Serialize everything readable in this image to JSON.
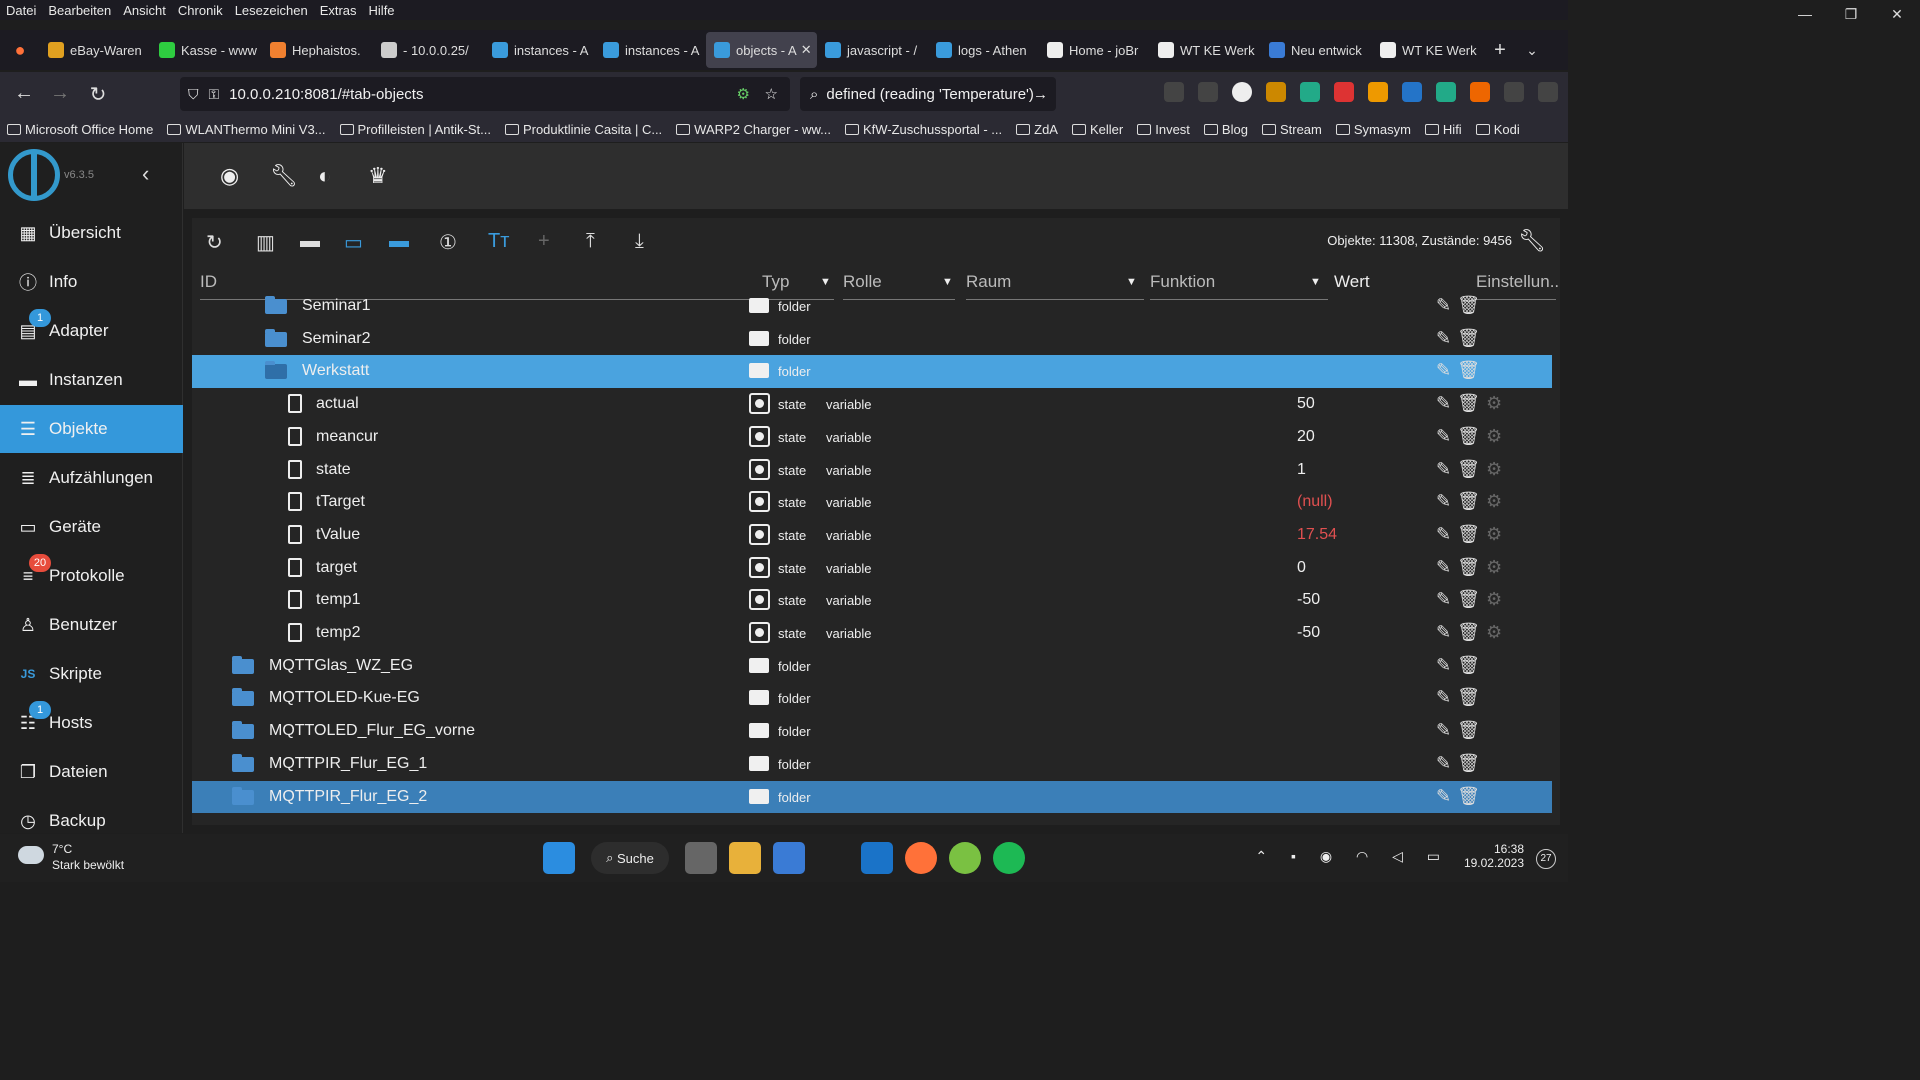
{
  "menu": [
    "Datei",
    "Bearbeiten",
    "Ansicht",
    "Chronik",
    "Lesezeichen",
    "Extras",
    "Hilfe"
  ],
  "tabs": [
    {
      "label": "eBay-Waren",
      "color": "#e0a020"
    },
    {
      "label": "Kasse - www",
      "color": "#2ecc40"
    },
    {
      "label": "Hephaistos.",
      "color": "#f08030"
    },
    {
      "label": "- 10.0.0.25/",
      "color": "#cccccc"
    },
    {
      "label": "instances - A",
      "color": "#3a9bdc"
    },
    {
      "label": "instances - A",
      "color": "#3a9bdc"
    },
    {
      "label": "objects - A",
      "color": "#3a9bdc",
      "active": true
    },
    {
      "label": "javascript - /",
      "color": "#3a9bdc"
    },
    {
      "label": "logs - Athen",
      "color": "#3a9bdc"
    },
    {
      "label": "Home - joBr",
      "color": "#eeeeee"
    },
    {
      "label": "WT KE Werk",
      "color": "#eeeeee"
    },
    {
      "label": "Neu entwick",
      "color": "#3a7bd5"
    },
    {
      "label": "WT KE Werk",
      "color": "#eeeeee"
    }
  ],
  "url": "10.0.0.210:8081/#tab-objects",
  "search_text": "defined (reading 'Temperature')",
  "bookmarks": [
    "Microsoft Office Home",
    "WLANThermo Mini V3...",
    "Profilleisten | Antik-St...",
    "Produktlinie Casita | C...",
    "WARP2 Charger - ww...",
    "KfW-Zuschussportal - ...",
    "ZdA",
    "Keller",
    "Invest",
    "Blog",
    "Stream",
    "Symasym",
    "Hifi",
    "Kodi"
  ],
  "version": "v6.3.5",
  "nav": [
    {
      "label": "Übersicht",
      "icon": "▦"
    },
    {
      "label": "Info",
      "icon": "ⓘ"
    },
    {
      "label": "Adapter",
      "icon": "▤",
      "badge": "1",
      "badge_color": "#3498db"
    },
    {
      "label": "Instanzen",
      "icon": "▬"
    },
    {
      "label": "Objekte",
      "icon": "☰",
      "selected": true
    },
    {
      "label": "Aufzählungen",
      "icon": "≣"
    },
    {
      "label": "Geräte",
      "icon": "▭"
    },
    {
      "label": "Protokolle",
      "icon": "≡",
      "badge": "20",
      "badge_color": "#e74c3c"
    },
    {
      "label": "Benutzer",
      "icon": "♙"
    },
    {
      "label": "Skripte",
      "icon": "JS"
    },
    {
      "label": "Hosts",
      "icon": "☷",
      "badge": "1",
      "badge_color": "#3498db"
    },
    {
      "label": "Dateien",
      "icon": "❐"
    },
    {
      "label": "Backup",
      "icon": "◷"
    }
  ],
  "stats": "Objekte: 11308, Zustände: 9456",
  "headers": {
    "id": "ID",
    "typ": "Typ",
    "rolle": "Rolle",
    "raum": "Raum",
    "funktion": "Funktion",
    "wert": "Wert",
    "settings": "Einstellun.."
  },
  "rows": [
    {
      "name": "Seminar1",
      "kind": "folder",
      "indent": 1,
      "typ": "folder"
    },
    {
      "name": "Seminar2",
      "kind": "folder",
      "indent": 1,
      "typ": "folder"
    },
    {
      "name": "Werkstatt",
      "kind": "folder-open",
      "indent": 1,
      "typ": "folder",
      "selected": true
    },
    {
      "name": "actual",
      "kind": "state",
      "indent": 2,
      "typ": "state",
      "role": "variable",
      "value": "50"
    },
    {
      "name": "meancur",
      "kind": "state",
      "indent": 2,
      "typ": "state",
      "role": "variable",
      "value": "20"
    },
    {
      "name": "state",
      "kind": "state",
      "indent": 2,
      "typ": "state",
      "role": "variable",
      "value": "1"
    },
    {
      "name": "tTarget",
      "kind": "state",
      "indent": 2,
      "typ": "state",
      "role": "variable",
      "value": "(null)",
      "red": true
    },
    {
      "name": "tValue",
      "kind": "state",
      "indent": 2,
      "typ": "state",
      "role": "variable",
      "value": "17.54",
      "red": true
    },
    {
      "name": "target",
      "kind": "state",
      "indent": 2,
      "typ": "state",
      "role": "variable",
      "value": "0"
    },
    {
      "name": "temp1",
      "kind": "state",
      "indent": 2,
      "typ": "state",
      "role": "variable",
      "value": "-50"
    },
    {
      "name": "temp2",
      "kind": "state",
      "indent": 2,
      "typ": "state",
      "role": "variable",
      "value": "-50"
    },
    {
      "name": "MQTTGlas_WZ_EG",
      "kind": "folder",
      "indent": 0,
      "typ": "folder"
    },
    {
      "name": "MQTTOLED-Kue-EG",
      "kind": "folder",
      "indent": 0,
      "typ": "folder"
    },
    {
      "name": "MQTTOLED_Flur_EG_vorne",
      "kind": "folder",
      "indent": 0,
      "typ": "folder"
    },
    {
      "name": "MQTTPIR_Flur_EG_1",
      "kind": "folder",
      "indent": 0,
      "typ": "folder"
    },
    {
      "name": "MQTTPIR_Flur_EG_2",
      "kind": "folder",
      "indent": 0,
      "typ": "folder",
      "selected2": true
    }
  ],
  "weather": {
    "temp": "7°C",
    "desc": "Stark bewölkt"
  },
  "taskbar_search": "Suche",
  "clock": {
    "time": "16:38",
    "date": "19.02.2023"
  },
  "notifications": "27"
}
